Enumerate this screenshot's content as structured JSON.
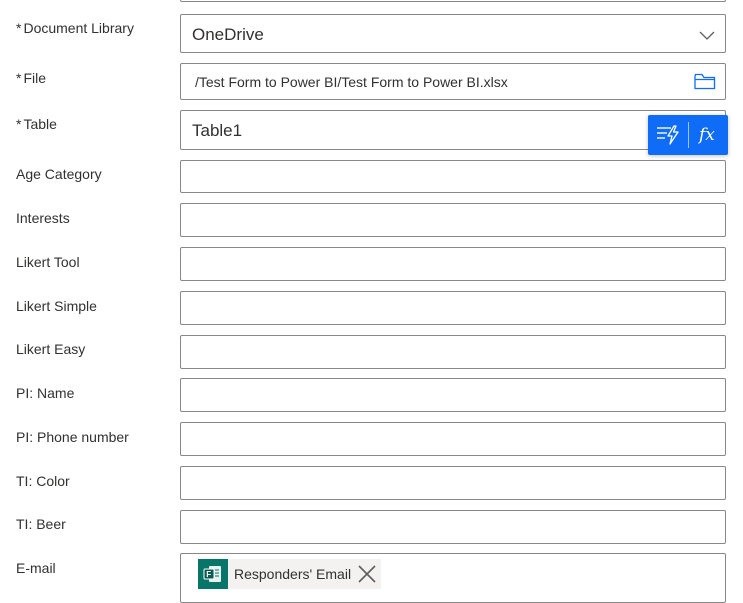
{
  "form": {
    "document_library": {
      "required_mark": "*",
      "label": "Document Library",
      "value": "OneDrive"
    },
    "file": {
      "required_mark": "*",
      "label": "File",
      "value": "/Test Form to Power BI/Test Form to Power BI.xlsx"
    },
    "table": {
      "required_mark": "*",
      "label": "Table",
      "value": "Table1"
    },
    "age_category": {
      "label": "Age Category",
      "value": ""
    },
    "interests": {
      "label": "Interests",
      "value": ""
    },
    "likert_tool": {
      "label": "Likert Tool",
      "value": ""
    },
    "likert_simple": {
      "label": "Likert Simple",
      "value": ""
    },
    "likert_easy": {
      "label": "Likert Easy",
      "value": ""
    },
    "pi_name": {
      "label": "PI: Name",
      "value": ""
    },
    "pi_phone": {
      "label": "PI: Phone number",
      "value": ""
    },
    "ti_color": {
      "label": "TI: Color",
      "value": ""
    },
    "ti_beer": {
      "label": "TI: Beer",
      "value": ""
    },
    "email": {
      "label": "E-mail",
      "token_label": "Responders' Email"
    }
  },
  "expression_popup": {
    "dynamic_content_icon": "dynamic-content-icon",
    "expression_icon": "fx-icon"
  },
  "colors": {
    "accent": "#0f6cf6",
    "forms_token": "#077568",
    "border": "#8a8886"
  }
}
